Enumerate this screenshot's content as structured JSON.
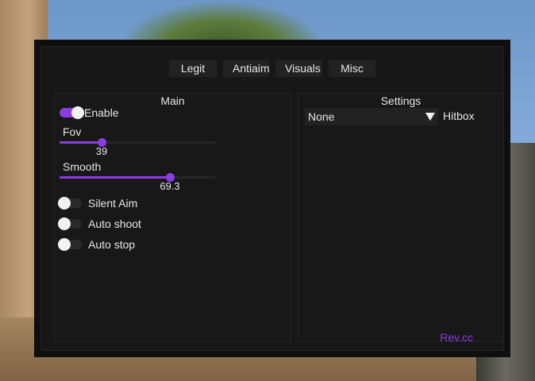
{
  "tabs": [
    "Legit",
    "Antiaim",
    "Visuals",
    "Misc"
  ],
  "left_panel": {
    "title": "Main",
    "enable": {
      "label": "Enable",
      "on": true
    },
    "fov": {
      "label": "Fov",
      "value": "39",
      "fraction": 0.27
    },
    "smooth": {
      "label": "Smooth",
      "value": "69.3",
      "fraction": 0.71
    },
    "toggles": [
      {
        "label": "Silent Aim",
        "on": false
      },
      {
        "label": "Auto shoot",
        "on": false
      },
      {
        "label": "Auto stop",
        "on": false
      }
    ]
  },
  "right_panel": {
    "title": "Settings",
    "hitbox": {
      "selected": "None",
      "label": "Hitbox"
    }
  },
  "brand": "Rev.cc",
  "colors": {
    "accent": "#8a3de0",
    "panel": "#181818",
    "window": "#0f0f0f"
  }
}
